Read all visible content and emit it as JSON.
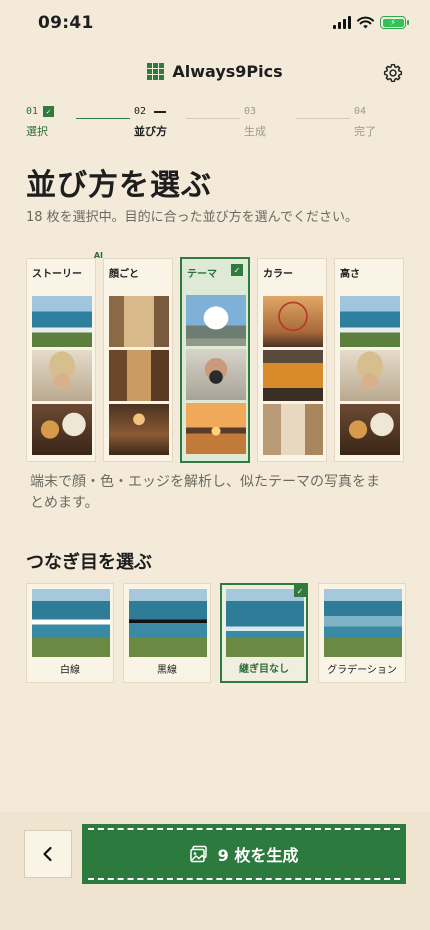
{
  "status_bar": {
    "time": "09:41",
    "battery_icon": "battery-charging-icon"
  },
  "header": {
    "app_name": "Always9Pics",
    "logo_icon": "grid-logo-icon",
    "settings_icon": "gear-icon"
  },
  "stepper": [
    {
      "num": "01",
      "label": "選択",
      "state": "done"
    },
    {
      "num": "02",
      "label": "並び方",
      "state": "active"
    },
    {
      "num": "03",
      "label": "生成",
      "state": "inactive"
    },
    {
      "num": "04",
      "label": "完了",
      "state": "inactive"
    }
  ],
  "page": {
    "title": "並び方を選ぶ",
    "subtitle": "18 枚を選択中。目的に合った並び方を選んでください。",
    "description": "端末で顔・色・エッジを解析し、似たテーマの写真をまとめます。",
    "ai_badge": "AI"
  },
  "arrangements": [
    {
      "label": "ストーリー",
      "photos": [
        "coast",
        "portrait-hat",
        "breakfast"
      ]
    },
    {
      "label": "顔ごと",
      "photos": [
        "alley",
        "cafe-interior",
        "market"
      ]
    },
    {
      "label": "テーマ",
      "photos": [
        "mountain-clouds",
        "photographer",
        "sunset-city"
      ],
      "selected": true
    },
    {
      "label": "カラー",
      "photos": [
        "ferris-wheel",
        "tram",
        "street"
      ]
    },
    {
      "label": "高さ",
      "photos": [
        "coast",
        "portrait-hat",
        "breakfast"
      ]
    }
  ],
  "seams": {
    "title": "つなぎ目を選ぶ",
    "options": [
      {
        "label": "白線"
      },
      {
        "label": "黒線"
      },
      {
        "label": "継ぎ目なし",
        "selected": true
      },
      {
        "label": "グラデーション"
      }
    ]
  },
  "footer": {
    "back_icon": "chevron-left-icon",
    "generate_label": "9 枚を生成",
    "generate_icon": "images-icon"
  },
  "colors": {
    "accent": "#2d7a3f",
    "background": "#f3ead9"
  }
}
